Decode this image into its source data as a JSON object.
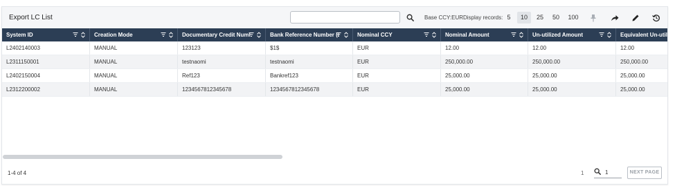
{
  "title": "Export LC List",
  "search": {
    "placeholder": "",
    "value": ""
  },
  "base_ccy": "Base CCY:EUR",
  "display_records_label": "Display records:",
  "page_sizes": [
    "5",
    "10",
    "25",
    "50",
    "100"
  ],
  "active_page_size": "10",
  "toolbar_icons": [
    "search-icon",
    "pin-icon",
    "share-icon",
    "edit-icon",
    "history-icon"
  ],
  "columns": [
    "System ID",
    "Creation Mode",
    "Documentary Credit Numl",
    "Bank Reference Number (/",
    "Nominal CCY",
    "Nominal Amount",
    "Un-utilized Amount",
    "Equivalent Un-utiliz"
  ],
  "rows": [
    [
      "L2402140003",
      "MANUAL",
      "123123",
      "$1$",
      "EUR",
      "12.00",
      "12.00",
      "12.00"
    ],
    [
      "L2311150001",
      "MANUAL",
      "testnaomi",
      "testnaomi",
      "EUR",
      "250,000.00",
      "250,000.00",
      "250,000.00"
    ],
    [
      "L2402150004",
      "MANUAL",
      "Ref123",
      "Bankref123",
      "EUR",
      "25,000.00",
      "25,000.00",
      "25,000.00"
    ],
    [
      "L2312200002",
      "MANUAL",
      "1234567812345678",
      "1234567812345678",
      "EUR",
      "25,000.00",
      "25,000.00",
      "25,000.00"
    ]
  ],
  "footer": {
    "count": "1-4 of 4",
    "current_page": "1",
    "goto_value": "1",
    "next_label": "NEXT PAGE"
  },
  "colors": {
    "header_bg": "#2c3e55",
    "alt_row": "#f2f3f5",
    "toolbar_bg": "#f5f6f8"
  }
}
